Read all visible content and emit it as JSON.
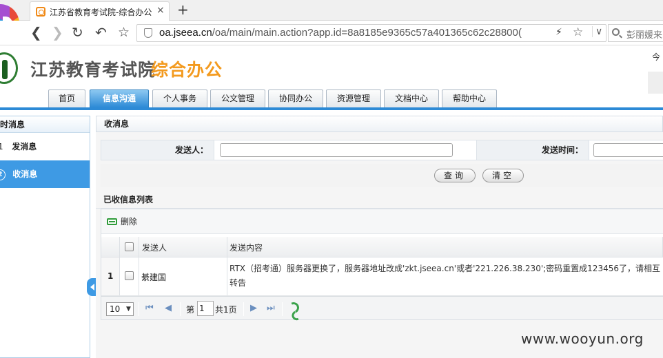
{
  "browser": {
    "tab_title": "江苏省教育考试院-综合办公",
    "tab_close": "×",
    "new_tab": "+",
    "url_host": "oa.jseea.cn",
    "url_path": "/oa/main/main.action?app.id=8a8185e9365c57a401365c62c28800(",
    "search_text": "彭丽媛来",
    "icons": [
      "back-icon",
      "forward-icon",
      "reload-icon",
      "undo-icon",
      "star-icon",
      "shield-icon",
      "bolt-icon",
      "search-icon"
    ]
  },
  "header": {
    "org_name": "江苏教育考试院",
    "app_name": "综合办公",
    "today_label": "今",
    "accent_color": "#f39a1e"
  },
  "nav": {
    "tabs": [
      {
        "label": "首页",
        "active": false
      },
      {
        "label": "信息沟通",
        "active": true
      },
      {
        "label": "个人事务",
        "active": false
      },
      {
        "label": "公文管理",
        "active": false
      },
      {
        "label": "协同办公",
        "active": false
      },
      {
        "label": "资源管理",
        "active": false
      },
      {
        "label": "文档中心",
        "active": false
      },
      {
        "label": "帮助中心",
        "active": false
      }
    ],
    "active_color": "#2d8ad6"
  },
  "sidebar": {
    "title": "即时消息",
    "items": [
      {
        "num": "1",
        "label": "发消息",
        "active": false
      },
      {
        "num": "2",
        "label": "收消息",
        "active": true
      }
    ]
  },
  "main": {
    "panel_title": "收消息",
    "filter": {
      "sender_label": "发送人：",
      "sender_value": "",
      "time_label": "发送时间：",
      "time_value": ""
    },
    "buttons": {
      "query": "查询",
      "clear": "清空"
    },
    "list_title": "已收信息列表",
    "toolbar": {
      "delete_label": "删除"
    },
    "table": {
      "columns": [
        "发送人",
        "发送内容"
      ],
      "rows": [
        {
          "num": "1",
          "sender": "綦建国",
          "content": "RTX（招考通）服务器更换了，服务器地址改成'zkt.jseea.cn'或者'221.226.38.230';密码重置成123456了，请相互转告"
        }
      ]
    },
    "pager": {
      "page_size": "10",
      "page_prefix": "第",
      "page_value": "1",
      "page_suffix": "共1页"
    }
  },
  "watermark": "www.wooyun.org"
}
